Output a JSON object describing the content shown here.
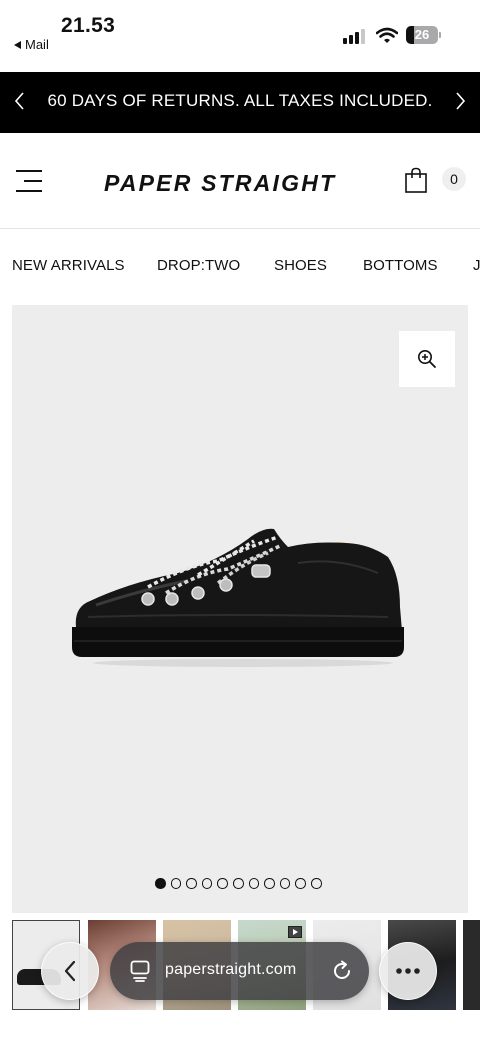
{
  "status_bar": {
    "time": "21.53",
    "back_label": "Mail",
    "battery": "26"
  },
  "announcement": {
    "text": "60 DAYS OF RETURNS. ALL TAXES INCLUDED."
  },
  "header": {
    "logo": "PAPER STRAIGHT",
    "cart_count": "0"
  },
  "nav": {
    "items": [
      "NEW ARRIVALS",
      "DROP:TWO",
      "SHOES",
      "BOTTOMS",
      "J"
    ]
  },
  "product": {
    "image_count": 11,
    "active_index": 0
  },
  "browser": {
    "url": "paperstraight.com"
  },
  "colors": {
    "announcement_bg": "#000000",
    "image_bg": "#ededed",
    "accent": "#111111"
  },
  "icons": {
    "back": "chevron-left-icon",
    "menu": "hamburger-menu-icon",
    "cart": "shopping-bag-icon",
    "zoom": "zoom-in-icon",
    "reload": "reload-icon",
    "more": "ellipsis-icon"
  }
}
